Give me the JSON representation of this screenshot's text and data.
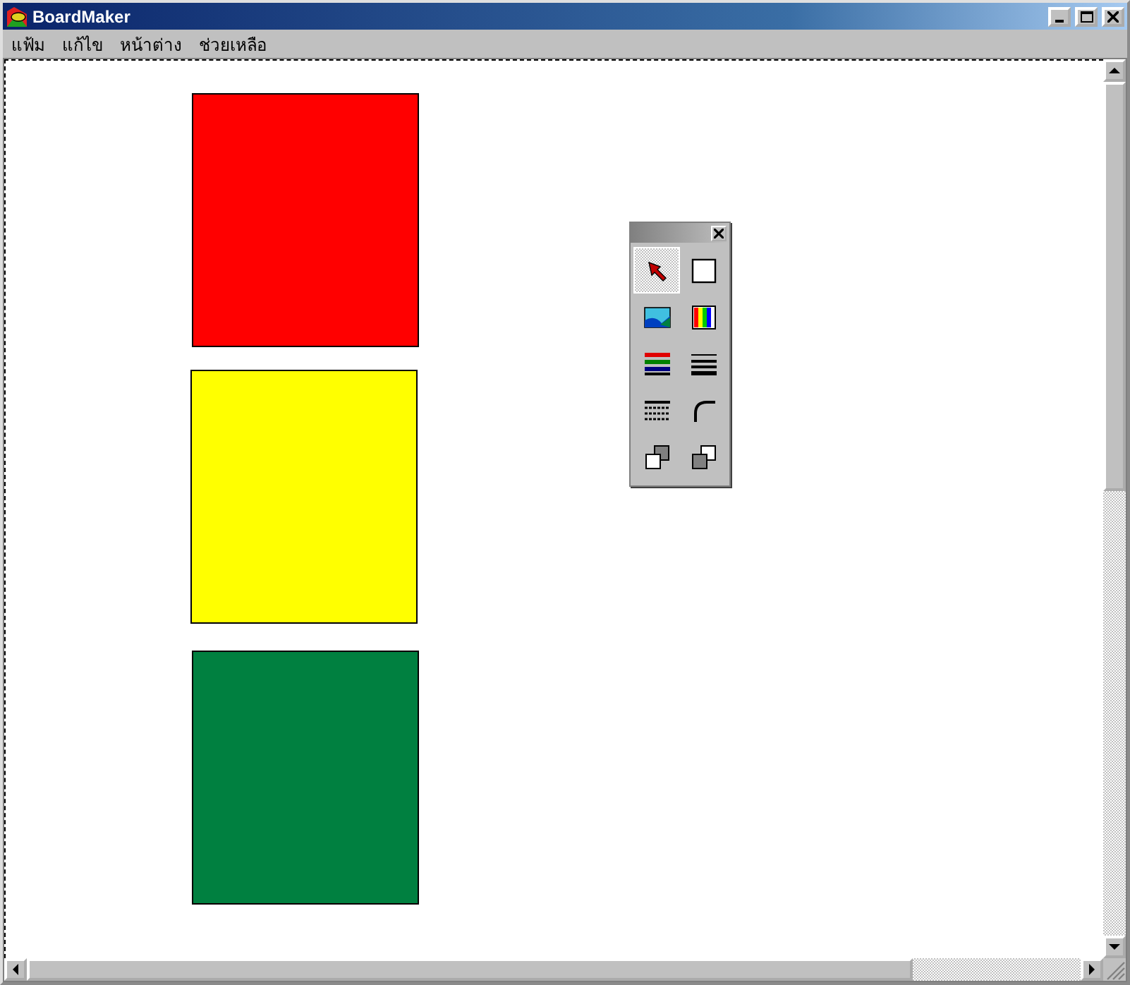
{
  "window": {
    "title": "BoardMaker"
  },
  "menu": [
    "แฟ้ม",
    "แก้ไข",
    "หน้าต่าง",
    "ช่วยเหลือ"
  ],
  "shapes": [
    {
      "color": "#ff0000"
    },
    {
      "color": "#ffff00"
    },
    {
      "color": "#008040"
    }
  ],
  "palette": {
    "tools": [
      {
        "kind": "pointer",
        "selected": true
      },
      {
        "kind": "rectangle",
        "selected": false
      },
      {
        "kind": "image",
        "selected": false
      },
      {
        "kind": "colors",
        "selected": false
      },
      {
        "kind": "linecolor",
        "selected": false
      },
      {
        "kind": "lines",
        "selected": false
      },
      {
        "kind": "grid",
        "selected": false
      },
      {
        "kind": "corner",
        "selected": false
      },
      {
        "kind": "front",
        "selected": false
      },
      {
        "kind": "back",
        "selected": false
      }
    ]
  }
}
